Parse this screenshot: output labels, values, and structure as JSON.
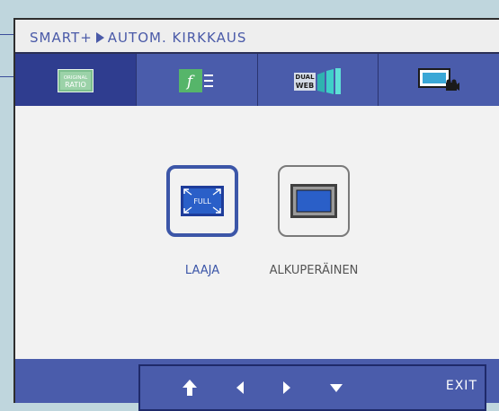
{
  "titlebar": {
    "menu": "SMART+",
    "submenu": "AUTOM. KIRKKAUS"
  },
  "tabs": [
    {
      "id": "original-ratio",
      "icon": "original-ratio-icon",
      "line1": "ORIGINAL",
      "line2": "RATIO",
      "selected": true
    },
    {
      "id": "f-engine",
      "icon": "f-engine-icon",
      "glyph": "f",
      "selected": false
    },
    {
      "id": "dual-web",
      "icon": "dual-web-icon",
      "line1": "DUAL",
      "line2": "WEB",
      "selected": false
    },
    {
      "id": "picture-in-picture",
      "icon": "video-screen-icon",
      "selected": false
    }
  ],
  "options": [
    {
      "id": "laaja",
      "label": "LAAJA",
      "badge": "FULL",
      "selected": true
    },
    {
      "id": "alkuperainen",
      "label": "ALKUPERÄINEN",
      "selected": false
    }
  ],
  "nav": {
    "exit_label": "EXIT"
  },
  "colors": {
    "accent": "#4a5cab",
    "selected_tab": "#2f3d8f",
    "label_selected": "#3c56a8",
    "label_unselected": "#555555"
  }
}
